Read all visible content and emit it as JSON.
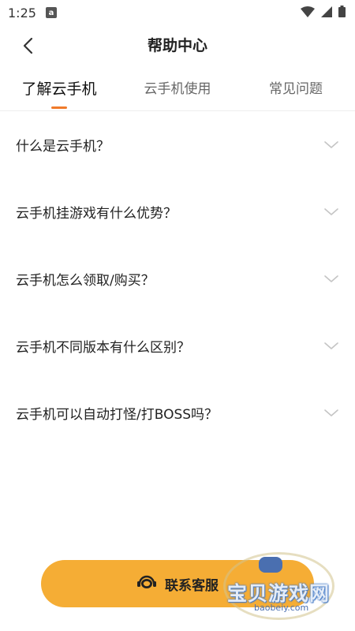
{
  "status": {
    "time": "1:25",
    "notif_icon": "a"
  },
  "header": {
    "title": "帮助中心"
  },
  "tabs": [
    {
      "label": "了解云手机",
      "active": true
    },
    {
      "label": "云手机使用",
      "active": false
    },
    {
      "label": "常见问题",
      "active": false
    }
  ],
  "faq": [
    {
      "question": "什么是云手机？"
    },
    {
      "question": "云手机挂游戏有什么优势？"
    },
    {
      "question": "云手机怎么领取/购买？"
    },
    {
      "question": "云手机不同版本有什么区别？"
    },
    {
      "question": "云手机可以自动打怪/打BOSS吗？"
    }
  ],
  "contact": {
    "label": "联系客服"
  },
  "watermark": {
    "title": "宝贝游戏网",
    "url": "baobeiy.com"
  },
  "colors": {
    "accent": "#f07a2a",
    "button": "#f5ad35"
  }
}
